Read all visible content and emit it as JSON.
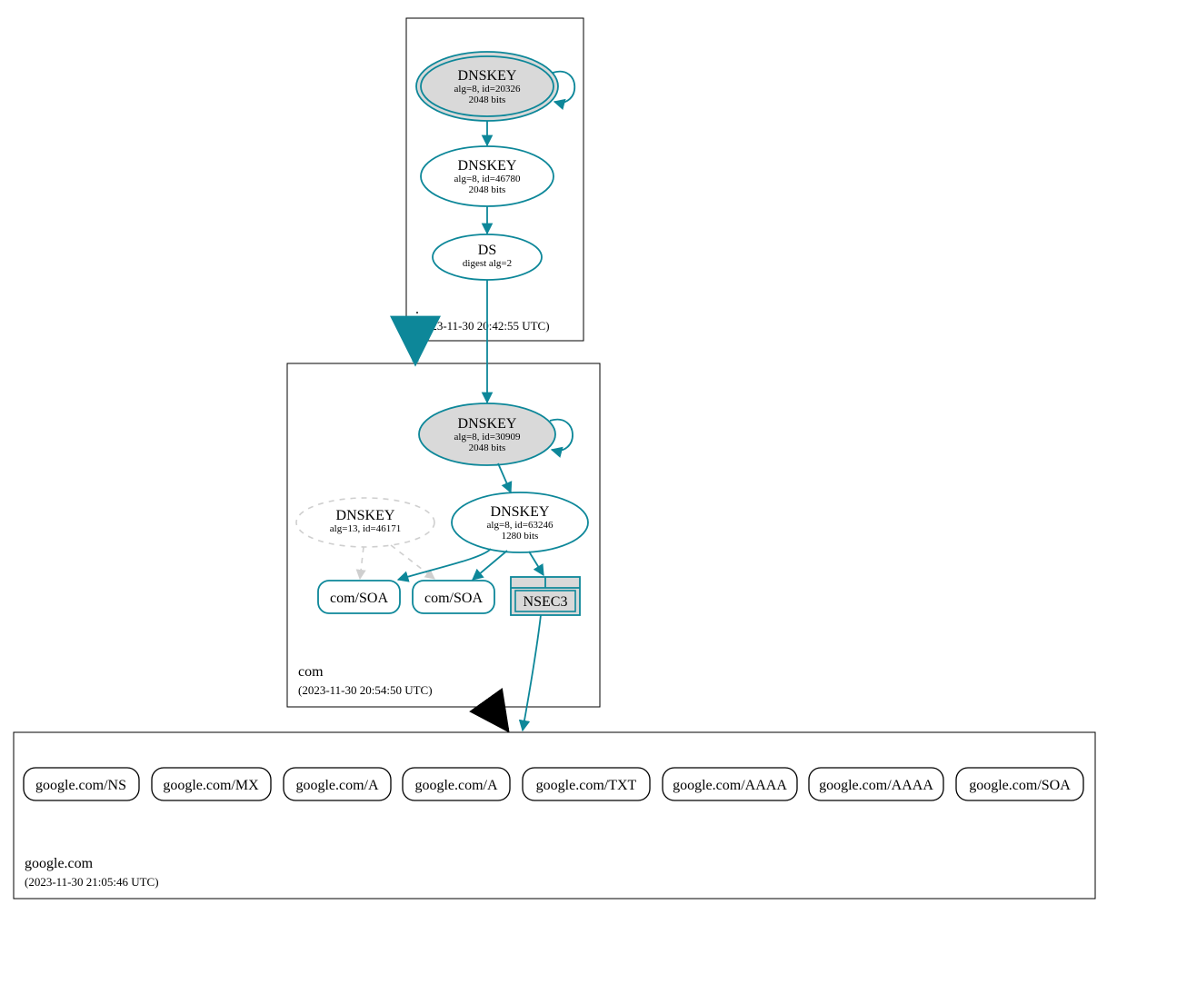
{
  "colors": {
    "teal": "#0d8799",
    "gray_fill": "#d9d9d9",
    "light_gray": "#cfcfcf",
    "black": "#000000"
  },
  "zones": {
    "root": {
      "name": ".",
      "time": "(2023-11-30 20:42:55 UTC)"
    },
    "com": {
      "name": "com",
      "time": "(2023-11-30 20:54:50 UTC)"
    },
    "google": {
      "name": "google.com",
      "time": "(2023-11-30 21:05:46 UTC)"
    }
  },
  "nodes": {
    "root_ksk": {
      "title": "DNSKEY",
      "sub1": "alg=8, id=20326",
      "sub2": "2048 bits"
    },
    "root_zsk": {
      "title": "DNSKEY",
      "sub1": "alg=8, id=46780",
      "sub2": "2048 bits"
    },
    "root_ds": {
      "title": "DS",
      "sub1": "digest alg=2"
    },
    "com_ksk": {
      "title": "DNSKEY",
      "sub1": "alg=8, id=30909",
      "sub2": "2048 bits"
    },
    "com_zsk": {
      "title": "DNSKEY",
      "sub1": "alg=8, id=63246",
      "sub2": "1280 bits"
    },
    "com_dnskey_dashed": {
      "title": "DNSKEY",
      "sub1": "alg=13, id=46171"
    },
    "com_soa_1": {
      "label": "com/SOA"
    },
    "com_soa_2": {
      "label": "com/SOA"
    },
    "nsec3": {
      "label": "NSEC3"
    }
  },
  "rrsets": [
    "google.com/NS",
    "google.com/MX",
    "google.com/A",
    "google.com/A",
    "google.com/TXT",
    "google.com/AAAA",
    "google.com/AAAA",
    "google.com/SOA"
  ]
}
